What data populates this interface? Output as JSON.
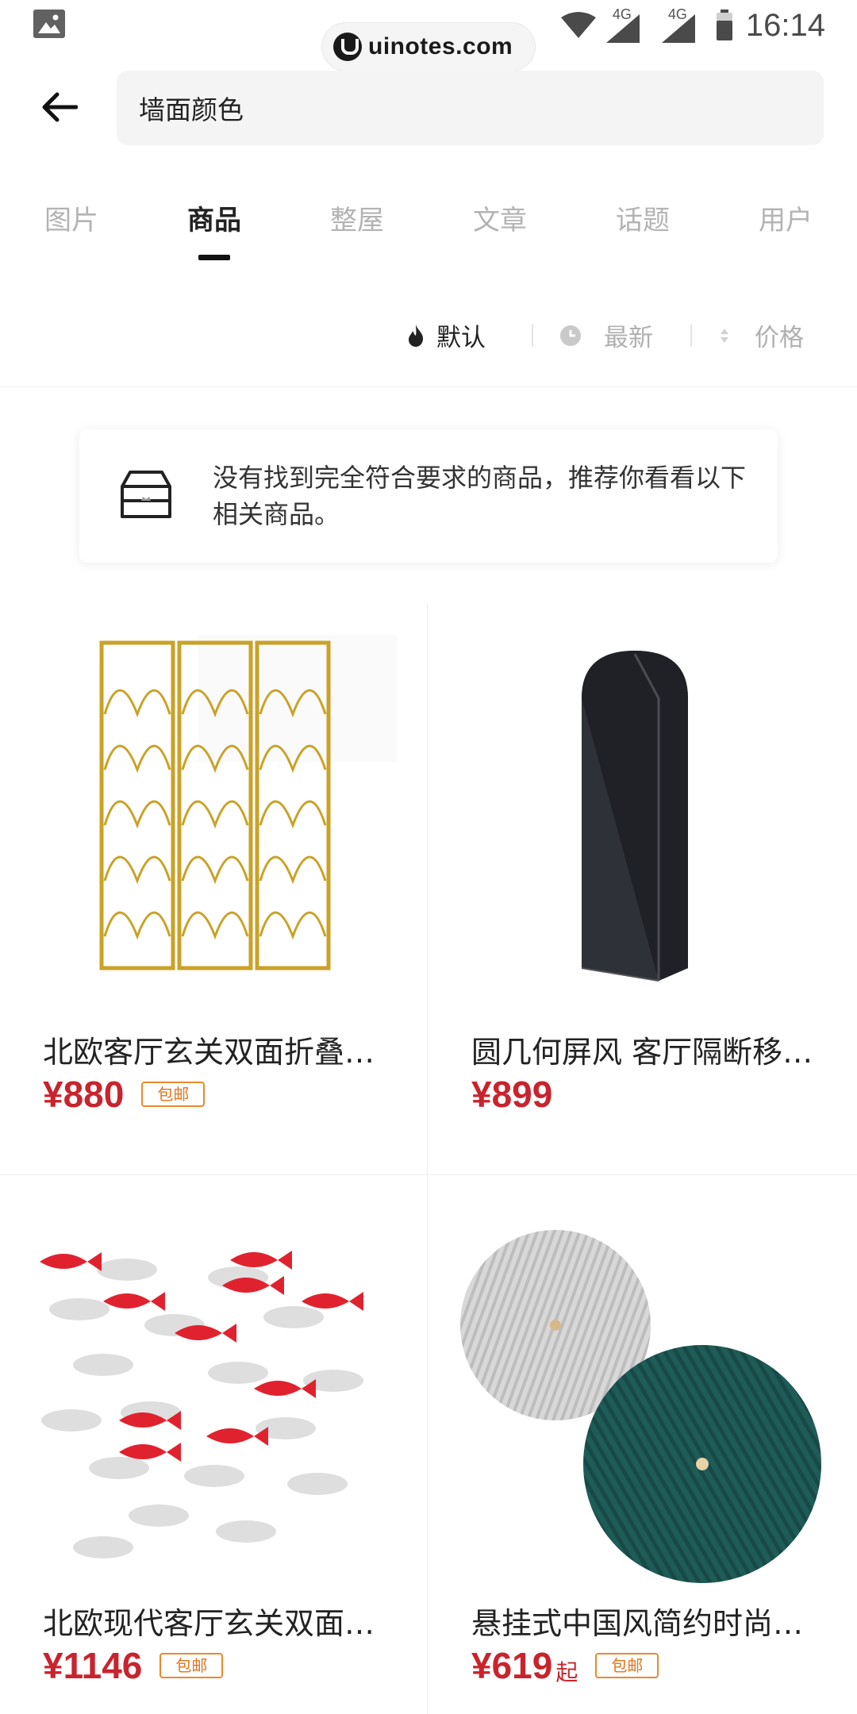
{
  "status_bar": {
    "time": "16:14",
    "network_1": "4G",
    "network_2": "4G"
  },
  "watermark": "uinotes.com",
  "search": {
    "query": "墙面颜色"
  },
  "tabs": [
    {
      "label": "图片",
      "active": false
    },
    {
      "label": "商品",
      "active": true
    },
    {
      "label": "整屋",
      "active": false
    },
    {
      "label": "文章",
      "active": false
    },
    {
      "label": "话题",
      "active": false
    },
    {
      "label": "用户",
      "active": false
    }
  ],
  "sort": {
    "default_label": "默认",
    "newest_label": "最新",
    "price_label": "价格"
  },
  "notice": {
    "text": "没有找到完全符合要求的商品，推荐你看看以下相关商品。"
  },
  "products": [
    {
      "title": "北欧客厅玄关双面折叠屏风",
      "price": "¥880",
      "suffix": "",
      "badge": "包邮"
    },
    {
      "title": "圆几何屏风 客厅隔断移动屏风",
      "price": "¥899",
      "suffix": "",
      "badge": ""
    },
    {
      "title": "北欧现代客厅玄关双面墙饰",
      "price": "¥1146",
      "suffix": "",
      "badge": "包邮"
    },
    {
      "title": "悬挂式中国风简约时尚墙饰",
      "price": "¥619",
      "suffix": "起",
      "badge": "包邮"
    }
  ],
  "colors": {
    "price": "#c8242d",
    "badge": "#e0731a",
    "tab_active": "#222222",
    "tab_inactive": "#b3b3b3"
  }
}
